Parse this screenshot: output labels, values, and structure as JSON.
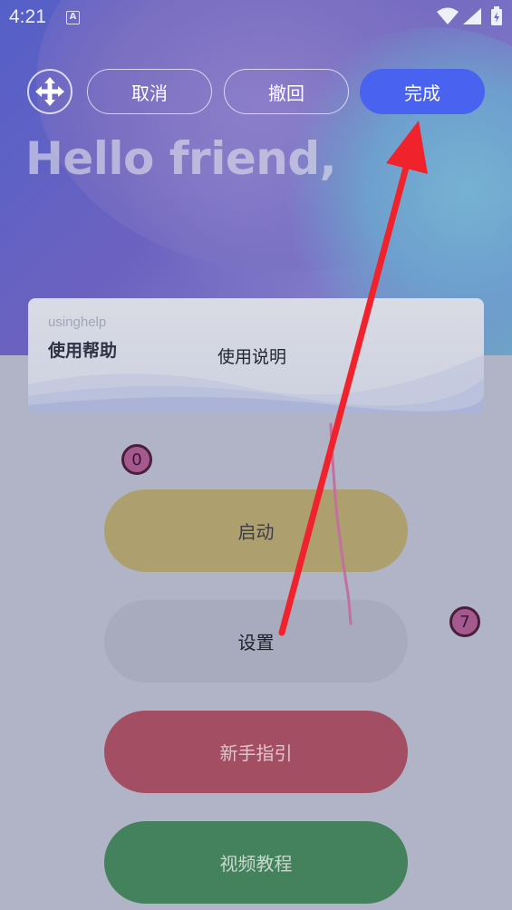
{
  "status_bar": {
    "time": "4:21",
    "keyboard_indicator": "A",
    "icons": [
      "wifi-icon",
      "signal-icon",
      "battery-icon"
    ]
  },
  "toolbar": {
    "move_icon": "move-arrows-icon",
    "cancel_label": "取消",
    "undo_label": "撤回",
    "done_label": "完成"
  },
  "greeting": "Hello friend,",
  "help_card": {
    "subtitle": "usinghelp",
    "title": "使用帮助",
    "link_label": "使用说明"
  },
  "badges": {
    "first": "0",
    "second": "7"
  },
  "actions": {
    "start_label": "启动",
    "settings_label": "设置",
    "guide_label": "新手指引",
    "video_label": "视频教程"
  },
  "colors": {
    "done_button": "#4a62f0",
    "start_button": "#ad9f6e",
    "settings_button": "#a8abbd",
    "guide_button": "#a44e63",
    "video_button": "#43825c",
    "arrow": "#f0232d",
    "badge": "#a45a8e"
  }
}
